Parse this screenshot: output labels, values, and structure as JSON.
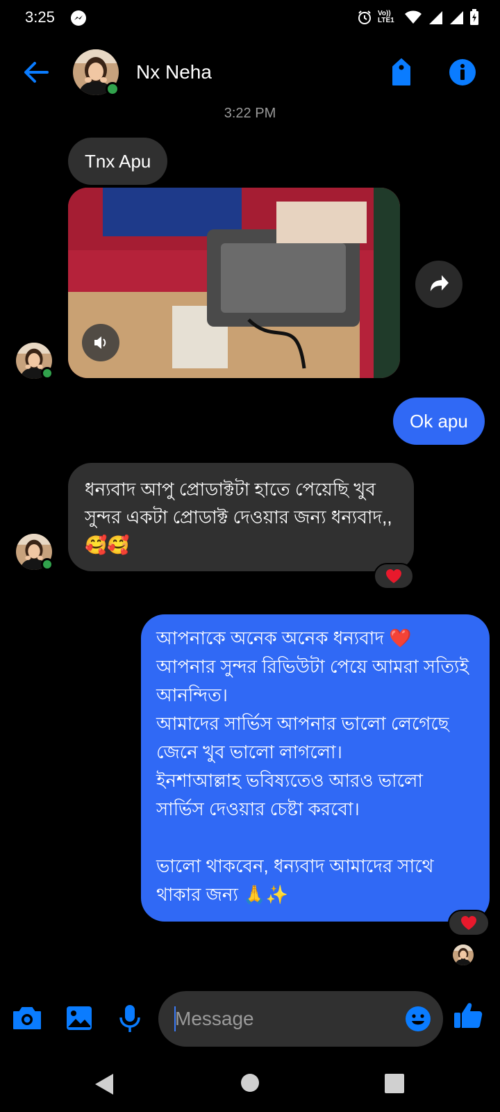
{
  "status_bar": {
    "time": "3:25",
    "network_label": "Vo)) LTE1"
  },
  "header": {
    "contact_name": "Nx Neha"
  },
  "conversation": {
    "timestamp": "3:22 PM",
    "messages": [
      {
        "direction": "incoming",
        "text": "Tnx Apu"
      },
      {
        "direction": "incoming",
        "type": "video"
      },
      {
        "direction": "outgoing",
        "text": "Ok apu"
      },
      {
        "direction": "incoming",
        "text": "ধন্যবাদ আপু প্রোডাক্টটা হাতে পেয়েছি খুব সুন্দর একটা প্রোডাক্ট দেওয়ার জন্য ধন্যবাদ,, 🥰🥰",
        "reaction": "❤️"
      },
      {
        "direction": "outgoing",
        "text": "আপনাকে অনেক অনেক ধন্যবাদ ❤️\nআপনার সুন্দর রিভিউটা পেয়ে আমরা সত্যিই আনন্দিত।\nআমাদের সার্ভিস আপনার ভালো লেগেছে জেনে খুব ভালো লাগলো।\nইনশাআল্লাহ ভবিষ্যতেও আরও ভালো সার্ভিস দেওয়ার চেষ্টা করবো।\n\nভালো থাকবেন, ধন্যবাদ আমাদের সাথে থাকার জন্য 🙏✨",
        "reaction": "❤️"
      }
    ]
  },
  "composer": {
    "placeholder": "Message"
  },
  "colors": {
    "accent": "#3069f5",
    "icon_blue": "#0a7cff",
    "incoming_bubble": "#303030",
    "online": "#31a24c",
    "heart": "#e8192c"
  },
  "icons": [
    "back-arrow-icon",
    "tag-icon",
    "info-icon",
    "volume-icon",
    "share-icon",
    "camera-icon",
    "image-icon",
    "microphone-icon",
    "emoji-icon",
    "thumbs-up-icon",
    "heart-icon"
  ]
}
